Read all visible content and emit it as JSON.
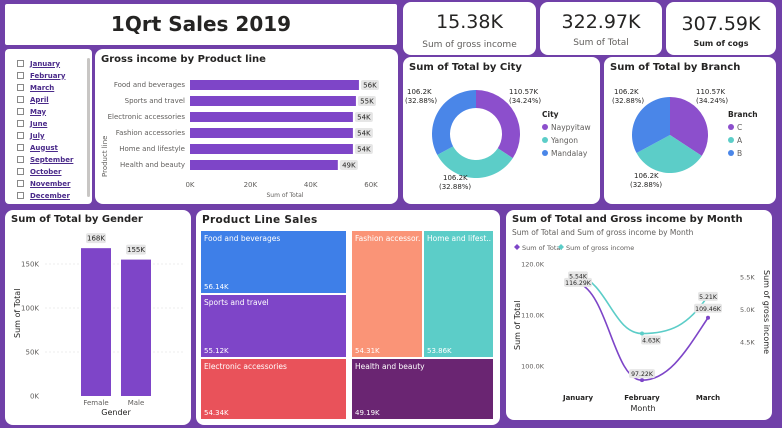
{
  "header": {
    "title": "1Qrt Sales 2019"
  },
  "kpis": [
    {
      "value": "15.38K",
      "label": "Sum of gross income"
    },
    {
      "value": "322.97K",
      "label": "Sum of Total"
    },
    {
      "value": "307.59K",
      "label": "Sum of cogs"
    }
  ],
  "slicer": {
    "items": [
      "January",
      "February",
      "March",
      "April",
      "May",
      "June",
      "July",
      "August",
      "September",
      "October",
      "November",
      "December"
    ]
  },
  "gross_income_chart": {
    "title": "Gross income by Product line",
    "ylabel": "Product line",
    "xlabel": "Sum of Total",
    "ticks": [
      "0K",
      "20K",
      "40K",
      "60K"
    ],
    "categories": [
      "Food and beverages",
      "Sports and travel",
      "Electronic accessories",
      "Fashion accessories",
      "Home and lifestyle",
      "Health and beauty"
    ],
    "values": [
      56,
      55,
      54,
      54,
      54,
      49
    ],
    "labels": [
      "56K",
      "55K",
      "54K",
      "54K",
      "54K",
      "49K"
    ]
  },
  "city_chart": {
    "title": "Sum of Total by City",
    "legend_title": "City",
    "legend": [
      "Naypyitaw",
      "Yangon",
      "Mandalay"
    ],
    "colors": [
      "#8c4fcc",
      "#5ccdc8",
      "#4a86e8"
    ],
    "values": [
      110.57,
      106.2,
      106.2
    ],
    "labels": [
      [
        "110.57K",
        "(34.24%)"
      ],
      [
        "106.2K",
        "(32.88%)"
      ],
      [
        "106.2K",
        "(32.88%)"
      ]
    ]
  },
  "branch_chart": {
    "title": "Sum of Total by Branch",
    "legend_title": "Branch",
    "legend": [
      "C",
      "A",
      "B"
    ],
    "colors": [
      "#8c4fcc",
      "#5ccdc8",
      "#4a86e8"
    ],
    "values": [
      110.57,
      106.2,
      106.2
    ],
    "labels": [
      [
        "110.57K",
        "(34.24%)"
      ],
      [
        "106.2K",
        "(32.88%)"
      ],
      [
        "106.2K",
        "(32.88%)"
      ]
    ]
  },
  "gender_chart": {
    "title": "Sum of Total by Gender",
    "ylabel": "Sum of Total",
    "xlabel": "Gender",
    "ticks": [
      "0K",
      "50K",
      "100K",
      "150K"
    ],
    "categories": [
      "Female",
      "Male"
    ],
    "values": [
      168,
      155
    ],
    "labels": [
      "168K",
      "155K"
    ]
  },
  "treemap": {
    "title": "Product Line Sales",
    "cells": [
      {
        "name": "Food and beverages",
        "value": "56.14K",
        "color": "#3e7fe8"
      },
      {
        "name": "Sports and travel",
        "value": "55.12K",
        "color": "#7e45c8"
      },
      {
        "name": "Electronic accessories",
        "value": "54.34K",
        "color": "#e9525a"
      },
      {
        "name": "Fashion accessor...",
        "value": "54.31K",
        "color": "#fa9477"
      },
      {
        "name": "Home and lifest...",
        "value": "53.86K",
        "color": "#5ccdc8"
      },
      {
        "name": "Health and beauty",
        "value": "49.19K",
        "color": "#6a2572"
      }
    ]
  },
  "month_chart": {
    "title": "Sum of Total and Gross income by Month",
    "subtitle": "Sum of Total and Sum of gross income by Month",
    "legend": [
      "Sum of Total",
      "Sum of gross income"
    ],
    "colors": [
      "#7d45c8",
      "#5ccdc8"
    ],
    "ylabel_left": "Sum of Total",
    "ylabel_right": "Sum of gross income",
    "xlabel": "Month",
    "months": [
      "January",
      "February",
      "March"
    ],
    "left_ticks": [
      "100.0K",
      "110.0K",
      "120.0K"
    ],
    "right_ticks": [
      "4.5K",
      "5.0K",
      "5.5K"
    ],
    "total": [
      116.29,
      97.22,
      109.46
    ],
    "total_labels": [
      "116.29K",
      "97.22K",
      "109.46K"
    ],
    "gross": [
      5.54,
      4.63,
      5.21
    ],
    "gross_labels": [
      "5.54K",
      "4.63K",
      "5.21K"
    ]
  },
  "chart_data": [
    {
      "type": "bar",
      "title": "Gross income by Product line",
      "categories": [
        "Food and beverages",
        "Sports and travel",
        "Electronic accessories",
        "Fashion accessories",
        "Home and lifestyle",
        "Health and beauty"
      ],
      "values": [
        56,
        55,
        54,
        54,
        54,
        49
      ],
      "xlabel": "Sum of Total",
      "ylabel": "Product line",
      "xlim": [
        0,
        60
      ]
    },
    {
      "type": "pie",
      "title": "Sum of Total by City",
      "categories": [
        "Naypyitaw",
        "Yangon",
        "Mandalay"
      ],
      "values": [
        110.57,
        106.2,
        106.2
      ]
    },
    {
      "type": "pie",
      "title": "Sum of Total by Branch",
      "categories": [
        "C",
        "A",
        "B"
      ],
      "values": [
        110.57,
        106.2,
        106.2
      ]
    },
    {
      "type": "bar",
      "title": "Sum of Total by Gender",
      "categories": [
        "Female",
        "Male"
      ],
      "values": [
        168,
        155
      ],
      "xlabel": "Gender",
      "ylabel": "Sum of Total",
      "ylim": [
        0,
        170
      ]
    },
    {
      "type": "heatmap",
      "title": "Product Line Sales",
      "categories": [
        "Food and beverages",
        "Sports and travel",
        "Electronic accessories",
        "Fashion accessories",
        "Home and lifestyle",
        "Health and beauty"
      ],
      "values": [
        56.14,
        55.12,
        54.34,
        54.31,
        53.86,
        49.19
      ]
    },
    {
      "type": "line",
      "title": "Sum of Total and Gross income by Month",
      "categories": [
        "January",
        "February",
        "March"
      ],
      "series": [
        {
          "name": "Sum of Total",
          "values": [
            116.29,
            97.22,
            109.46
          ]
        },
        {
          "name": "Sum of gross income",
          "values": [
            5.54,
            4.63,
            5.21
          ]
        }
      ],
      "xlabel": "Month",
      "ylabel": "Sum of Total"
    }
  ]
}
